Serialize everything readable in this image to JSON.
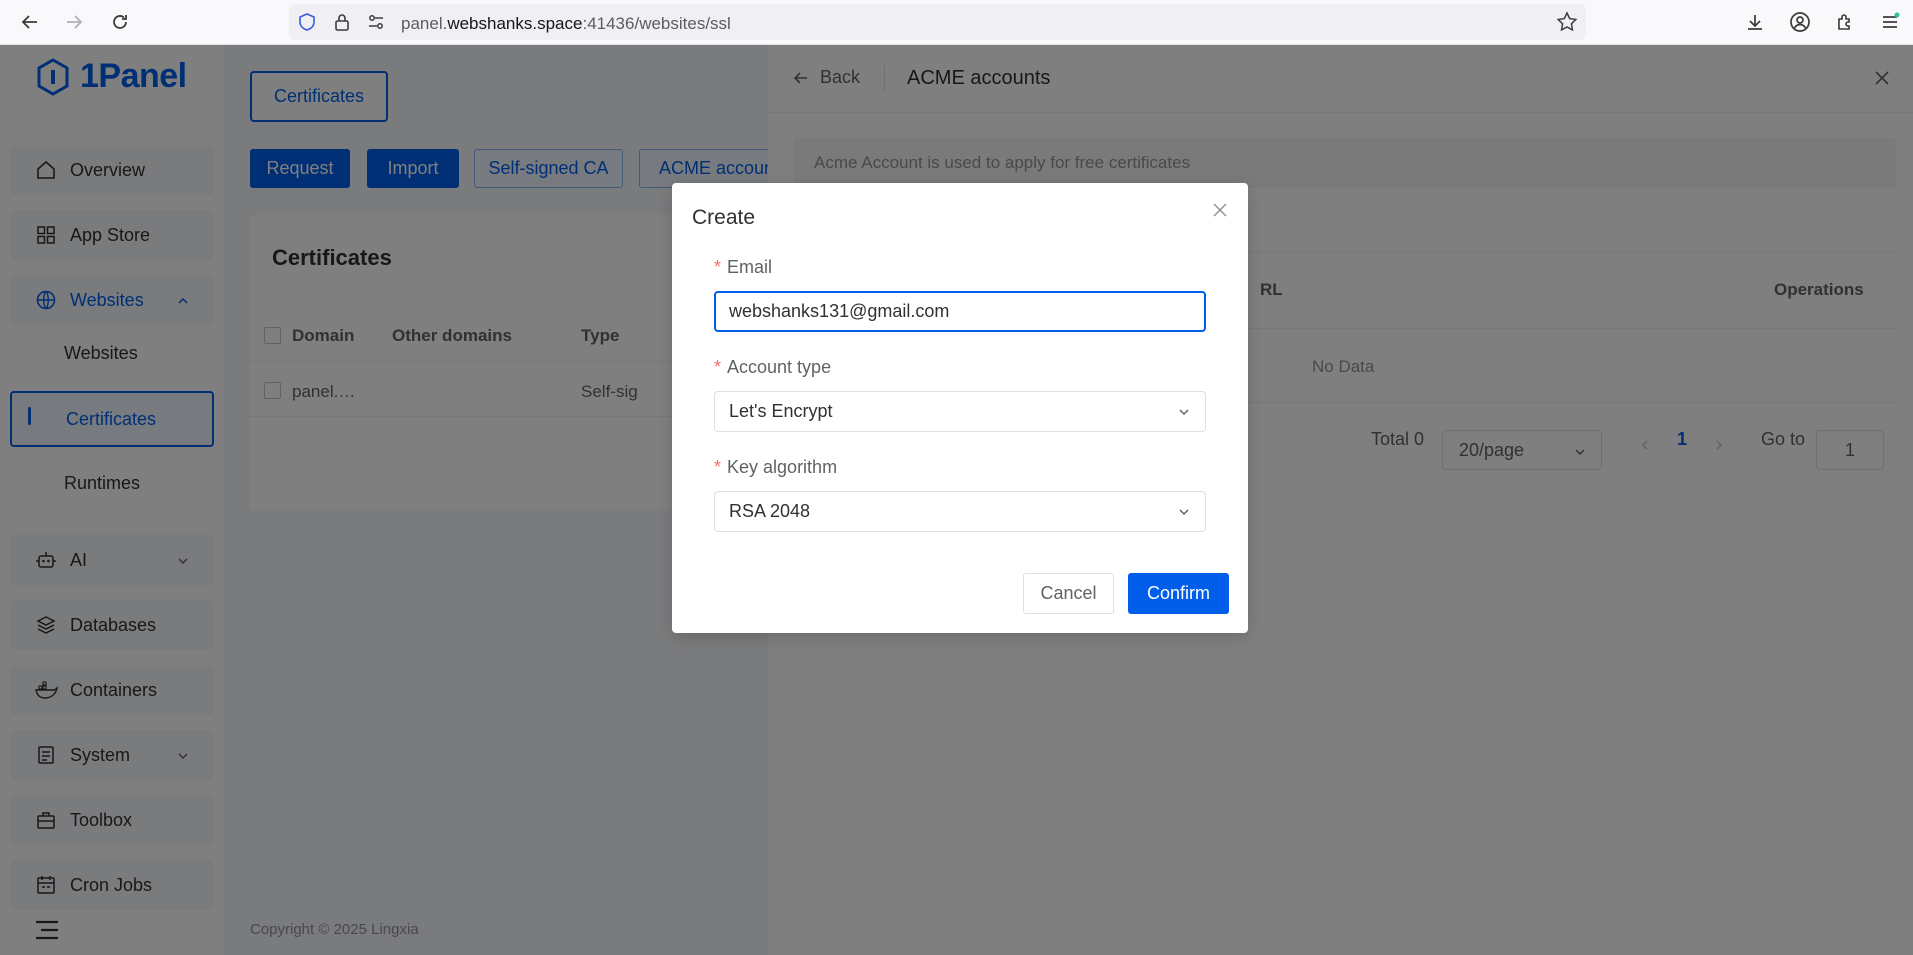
{
  "browser": {
    "url_prefix": "panel.",
    "url_domain": "webshanks.space",
    "url_suffix": ":41436/websites/ssl"
  },
  "sidebar": {
    "logo": "1Panel",
    "items": [
      {
        "label": "Overview",
        "icon": "home-icon"
      },
      {
        "label": "App Store",
        "icon": "grid-icon"
      },
      {
        "label": "Websites",
        "icon": "globe-icon"
      },
      {
        "label": "AI",
        "icon": "robot-icon"
      },
      {
        "label": "Databases",
        "icon": "layers-icon"
      },
      {
        "label": "Containers",
        "icon": "docker-icon"
      },
      {
        "label": "System",
        "icon": "system-icon"
      },
      {
        "label": "Toolbox",
        "icon": "toolbox-icon"
      },
      {
        "label": "Cron Jobs",
        "icon": "calendar-icon"
      }
    ],
    "sub_items": [
      "Websites",
      "Certificates",
      "Runtimes"
    ]
  },
  "main": {
    "tab": "Certificates",
    "actions": [
      "Request",
      "Import",
      "Self-signed CA",
      "ACME account"
    ],
    "card_title": "Certificates",
    "columns": [
      "Domain",
      "Other domains",
      "Type"
    ],
    "row": {
      "domain": "panel.…",
      "type": "Self-sig"
    },
    "footer": "Copyright © 2025 Lingxia"
  },
  "drawer": {
    "back": "Back",
    "title": "ACME accounts",
    "alert": "Acme Account is used to apply for free certificates",
    "columns": [
      "RL",
      "Operations"
    ],
    "no_data": "No Data",
    "total": "Total 0",
    "page_size": "20/page",
    "current_page": "1",
    "goto_label": "Go to",
    "goto_value": "1"
  },
  "dialog": {
    "title": "Create",
    "email_label": "Email",
    "email_value": "webshanks131@gmail.com",
    "account_type_label": "Account type",
    "account_type_value": "Let's Encrypt",
    "key_algorithm_label": "Key algorithm",
    "key_algorithm_value": "RSA 2048",
    "cancel": "Cancel",
    "confirm": "Confirm"
  },
  "colors": {
    "primary": "#005eeb",
    "required": "#f56c6c"
  }
}
